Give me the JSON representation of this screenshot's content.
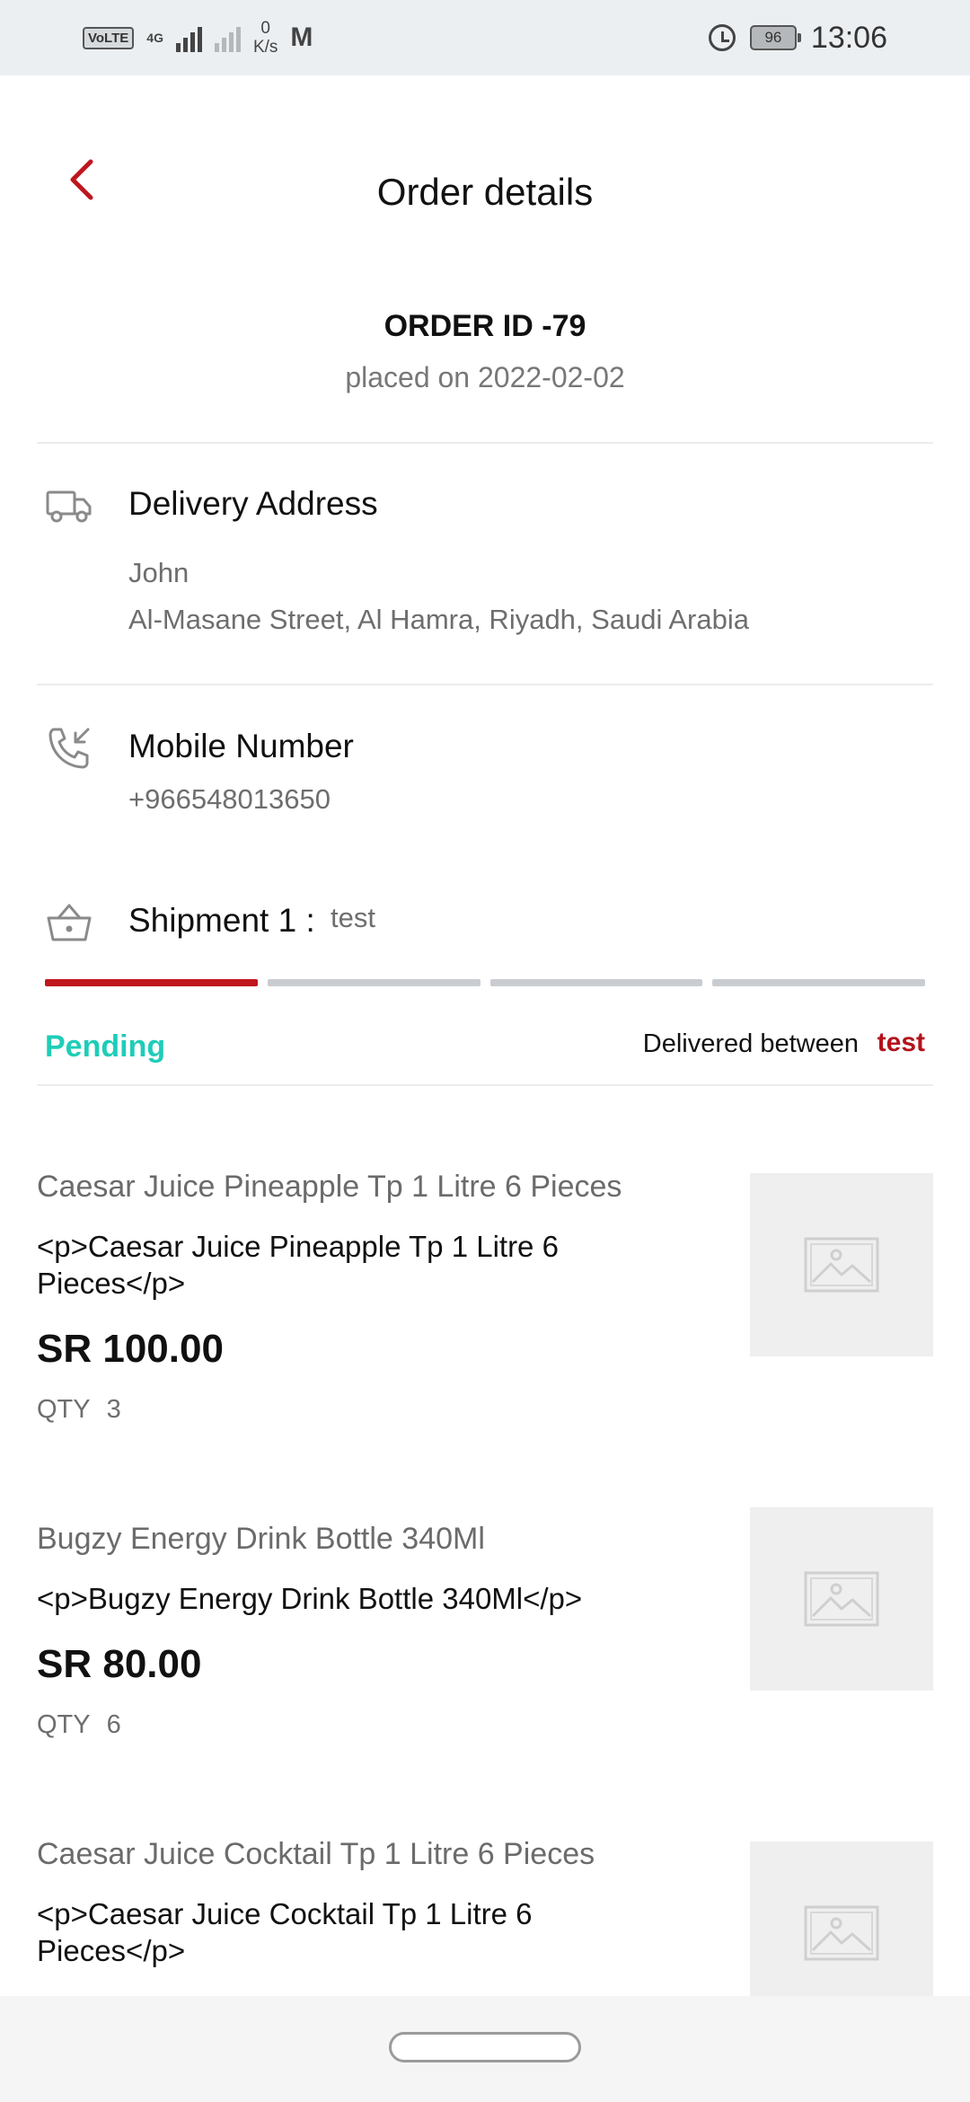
{
  "status_bar": {
    "volte": "VoLTE",
    "network": "4G",
    "speed_value": "0",
    "speed_unit": "K/s",
    "battery": "96",
    "time": "13:06"
  },
  "header": {
    "title": "Order details"
  },
  "order": {
    "id_label": "ORDER ID -79",
    "placed_on": "placed on 2022-02-02"
  },
  "delivery": {
    "title": "Delivery Address",
    "name": "John",
    "address": "Al-Masane Street, Al Hamra, Riyadh, Saudi Arabia"
  },
  "mobile": {
    "title": "Mobile Number",
    "number": "+966548013650"
  },
  "shipment": {
    "title": "Shipment 1 :",
    "note": "test",
    "progress_steps": 4,
    "progress_active": 1,
    "status": "Pending",
    "delivered_label": "Delivered between",
    "delivered_value": "test"
  },
  "products": [
    {
      "name": "Caesar Juice Pineapple Tp 1 Litre 6 Pieces",
      "description": "<p>Caesar Juice Pineapple Tp 1 Litre 6 Pieces</p>",
      "price": "SR 100.00",
      "qty_label": "QTY",
      "qty": "3"
    },
    {
      "name": "Bugzy Energy Drink Bottle 340Ml",
      "description": "<p>Bugzy Energy Drink Bottle 340Ml</p>",
      "price": "SR 80.00",
      "qty_label": "QTY",
      "qty": "6"
    },
    {
      "name": "Caesar Juice Cocktail Tp 1 Litre 6 Pieces",
      "description": "<p>Caesar Juice Cocktail Tp 1 Litre 6 Pieces</p>",
      "price": "",
      "qty_label": "",
      "qty": ""
    }
  ],
  "colors": {
    "accent": "#c0161e",
    "pending": "#1ecdb8",
    "muted": "#6e6e6e"
  },
  "icons": {
    "back": "chevron-left-icon",
    "delivery": "truck-icon",
    "mobile": "phone-incoming-icon",
    "shipment": "basket-icon",
    "product_image": "image-placeholder-icon"
  }
}
